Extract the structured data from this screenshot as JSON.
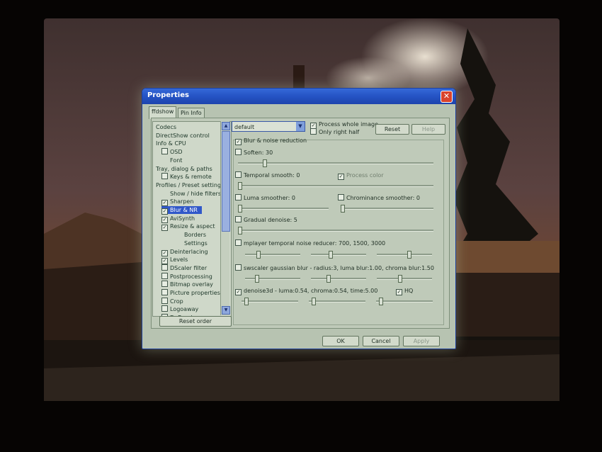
{
  "window": {
    "title": "Properties",
    "close_glyph": "✕"
  },
  "tabs": [
    {
      "label": "ffdshow",
      "active": true
    },
    {
      "label": "Pin Info",
      "active": false
    }
  ],
  "tree": {
    "items": [
      {
        "label": "Codecs",
        "checkbox": false
      },
      {
        "label": "DirectShow control",
        "checkbox": false
      },
      {
        "label": "Info & CPU",
        "checkbox": false
      },
      {
        "label": "OSD",
        "checkbox": true,
        "checked": false
      },
      {
        "label": "Font",
        "checkbox": false
      },
      {
        "label": "Tray, dialog & paths",
        "checkbox": false
      },
      {
        "label": "Keys & remote",
        "checkbox": true,
        "checked": false
      },
      {
        "label": "Profiles / Preset settings",
        "checkbox": false
      },
      {
        "label": "Show / hide filters",
        "checkbox": false
      },
      {
        "label": "Sharpen",
        "checkbox": true,
        "checked": true
      },
      {
        "label": "Blur & NR",
        "checkbox": true,
        "checked": true,
        "selected": true
      },
      {
        "label": "AviSynth",
        "checkbox": true,
        "checked": true
      },
      {
        "label": "Resize & aspect",
        "checkbox": true,
        "checked": true
      },
      {
        "label": "Borders",
        "checkbox": false
      },
      {
        "label": "Settings",
        "checkbox": false
      },
      {
        "label": "Deinterlacing",
        "checkbox": true,
        "checked": true
      },
      {
        "label": "Levels",
        "checkbox": true,
        "checked": true
      },
      {
        "label": "DScaler filter",
        "checkbox": true,
        "checked": false
      },
      {
        "label": "Postprocessing",
        "checkbox": true,
        "checked": false
      },
      {
        "label": "Bitmap overlay",
        "checkbox": true,
        "checked": false
      },
      {
        "label": "Picture properties",
        "checkbox": true,
        "checked": false
      },
      {
        "label": "Crop",
        "checkbox": true,
        "checked": false
      },
      {
        "label": "Logoaway",
        "checkbox": true,
        "checked": false
      },
      {
        "label": "DeBand",
        "checkbox": true,
        "checked": false
      }
    ],
    "reset_order": "Reset order"
  },
  "preset": {
    "value": "default"
  },
  "top_options": {
    "process_whole_image": {
      "label": "Process whole image",
      "checked": true
    },
    "only_right_half": {
      "label": "Only right half",
      "checked": false
    },
    "reset": "Reset",
    "help": "Help"
  },
  "blur": {
    "enable": {
      "label": "Blur & noise reduction",
      "checked": true
    },
    "soften": {
      "label": "Soften: 30",
      "checked": false,
      "level": 0.13
    },
    "temporal_smooth": {
      "label": "Temporal smooth: 0",
      "checked": false,
      "level": 0.0
    },
    "process_color": {
      "label": "Process color",
      "checked": true
    },
    "luma_smoother": {
      "label": "Luma smoother: 0",
      "checked": false,
      "level": 0.0
    },
    "chroma_smoother": {
      "label": "Chrominance smoother: 0",
      "checked": false,
      "level": 0.0
    },
    "gradual_denoise": {
      "label": "Gradual denoise: 5",
      "checked": false,
      "level": 0.0
    },
    "mplayer_tnr": {
      "label": "mplayer temporal noise reducer: 700, 1500, 3000",
      "checked": false,
      "levels": [
        0.22,
        0.35,
        0.6
      ]
    },
    "swscaler": {
      "label": "swscaler gaussian blur - radius:3, luma blur:1.00, chroma blur:1.50",
      "checked": false,
      "levels": [
        0.2,
        0.3,
        0.42
      ]
    },
    "denoise3d": {
      "label": "denoise3d - luma:0.54, chroma:0.54, time:5.00",
      "checked": true,
      "levels": [
        0.05,
        0.05,
        0.05
      ]
    },
    "hq": {
      "label": "HQ",
      "checked": true
    }
  },
  "buttons": {
    "ok": "OK",
    "cancel": "Cancel",
    "apply": "Apply"
  },
  "colors": {
    "title_bar": "#2553c4",
    "selection": "#3158c9",
    "dialog_bg": "#b7c3b1"
  }
}
